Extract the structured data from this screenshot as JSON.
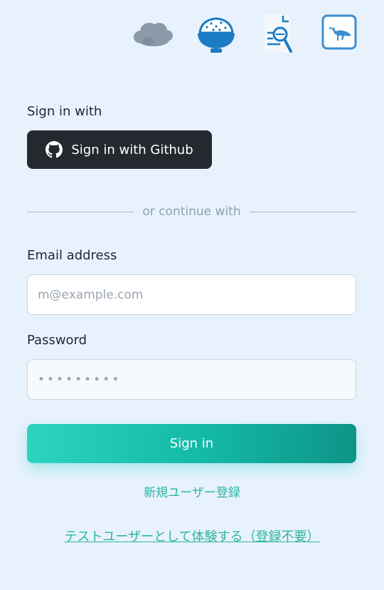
{
  "header": {
    "icons": [
      {
        "name": "cloud-icon",
        "color": "#8a9aa8"
      },
      {
        "name": "rice-bowl-icon",
        "color": "#1b7bc4"
      },
      {
        "name": "document-search-icon",
        "color": "#1b7bc4"
      },
      {
        "name": "bird-icon",
        "color": "#3b8fd0"
      }
    ]
  },
  "auth": {
    "signin_with_label": "Sign in with",
    "github_button_label": "Sign in with Github",
    "divider_text": "or continue with",
    "email_label": "Email address",
    "email_placeholder": "m@example.com",
    "password_label": "Password",
    "password_placeholder": "•••••••••",
    "signin_button_label": "Sign in",
    "register_link": "新規ユーザー登録",
    "test_user_link": "テストユーザーとして体験する（登録不要）"
  },
  "colors": {
    "background": "#e8f2fd",
    "github_button": "#24292f",
    "accent": "#2dd4bf",
    "link": "#2bb5a0"
  }
}
